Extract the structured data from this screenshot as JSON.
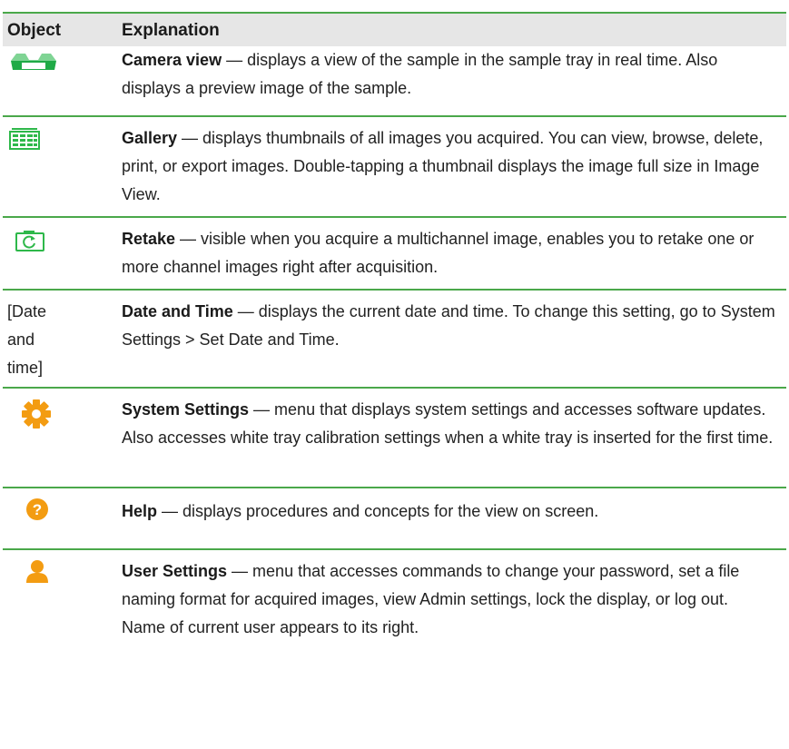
{
  "header": {
    "object": "Object",
    "explanation": "Explanation"
  },
  "colors": {
    "accent": "#4aa84a",
    "icon_green": "#2eb84a",
    "icon_orange": "#f39c12",
    "header_bg": "#e6e6e6"
  },
  "rows": [
    {
      "icon": "camera-view-icon",
      "title": "Camera view",
      "text": " — displays a view of the sample in the sample tray in real time. Also displays a preview image of the sample."
    },
    {
      "icon": "gallery-icon",
      "title": "Gallery",
      "text": " — displays thumbnails of all images you acquired. You can view, browse, delete, print, or export images. Double-tapping a thumbnail displays the image full size in Image View."
    },
    {
      "icon": "retake-icon",
      "title": "Retake",
      "text": " — visible when you acquire a multichannel image, enables you to retake one or more channel images right after acquisition."
    },
    {
      "object_text": "[Date and time]",
      "title": "Date and Time",
      "text": " — displays the current date and time. To change this setting, go to System Settings > Set Date and Time."
    },
    {
      "icon": "gear-icon",
      "title": "System Settings",
      "text": " — menu that displays system settings and accesses software updates. Also accesses white tray calibration settings when a white tray is inserted for the first time."
    },
    {
      "icon": "help-icon",
      "title": "Help",
      "text": " — displays procedures and concepts for the view on screen."
    },
    {
      "icon": "user-icon",
      "title": "User Settings",
      "text": " — menu that accesses commands to change your password, set a file naming format for acquired images, view Admin settings, lock the display, or log out. Name of current user appears to its right."
    }
  ]
}
